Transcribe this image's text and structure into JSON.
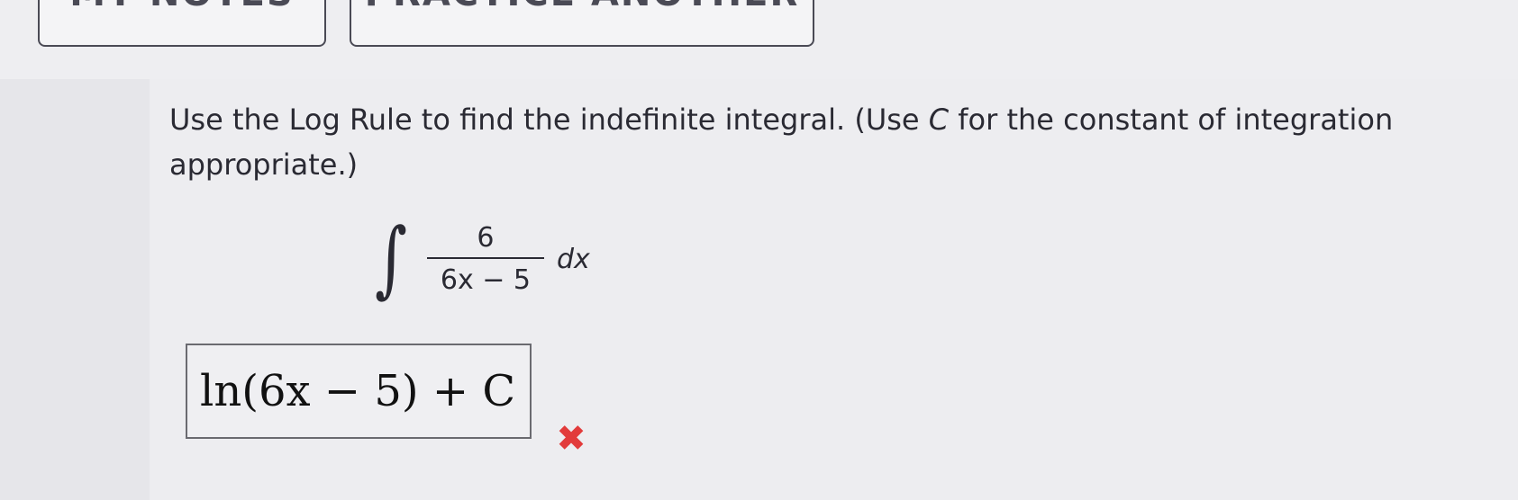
{
  "toolbar": {
    "my_notes_label": "MY NOTES",
    "practice_another_label": "PRACTICE ANOTHER"
  },
  "question": {
    "text_before_c": "Use the Log Rule to find the indefinite integral. (Use ",
    "c_symbol": "C",
    "text_after_c_line1": " for the constant of integration",
    "text_line2": "appropriate.)"
  },
  "integral": {
    "sign": "∫",
    "numerator": "6",
    "denominator": "6x − 5",
    "differential": "dx"
  },
  "answer": {
    "value": "ln(6x − 5) + C",
    "status": "incorrect",
    "status_icon": "cross-icon",
    "status_color": "#e23b3b"
  }
}
